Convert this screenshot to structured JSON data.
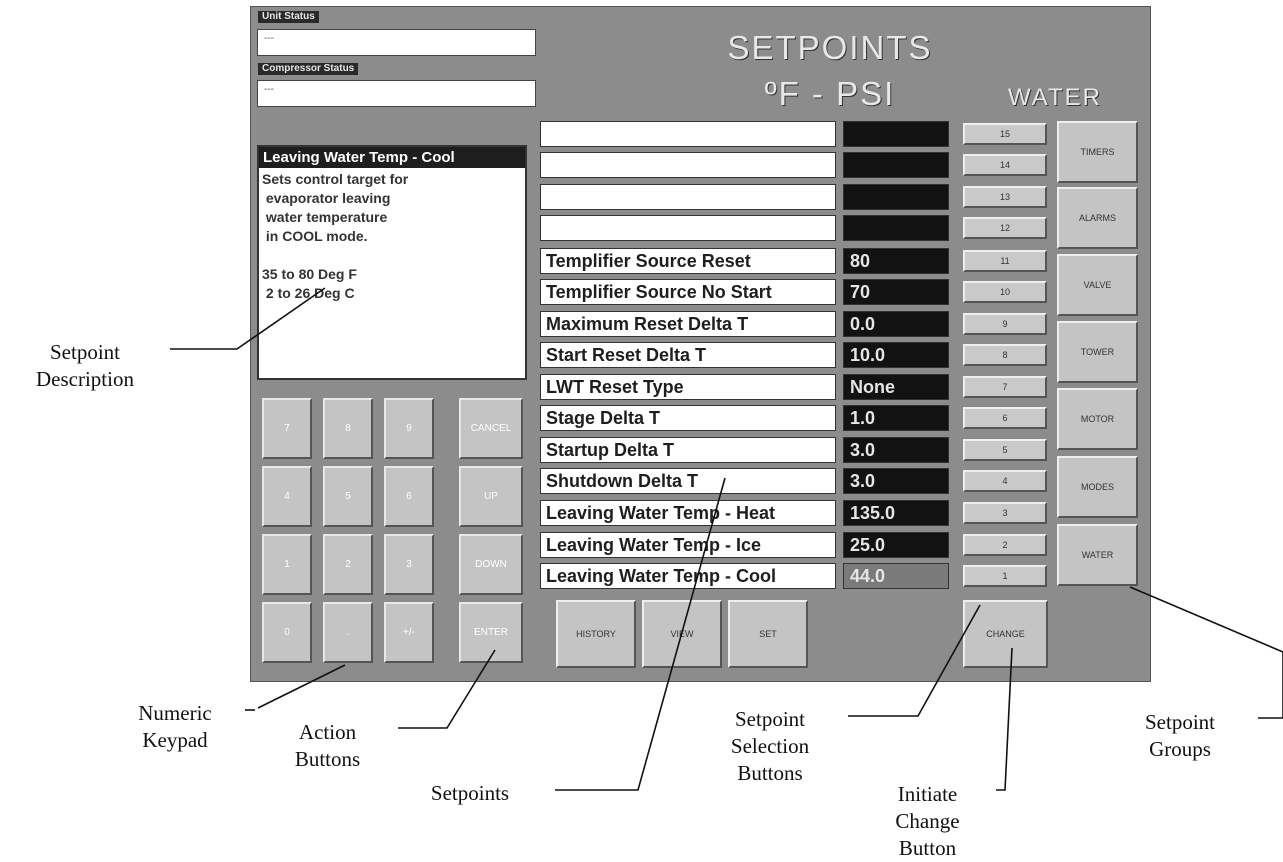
{
  "status": {
    "unit_label": "Unit Status",
    "unit_value": "---",
    "compressor_label": "Compressor Status",
    "compressor_value": "---"
  },
  "title": {
    "line1": "SETPOINTS",
    "line2": "ºF - PSI",
    "group": "WATER"
  },
  "description": {
    "heading": "Leaving Water Temp - Cool",
    "text": "Sets control target for\n evaporator leaving\n water temperature\n in COOL mode.\n\n35 to 80 Deg F\n 2 to 26 Deg C"
  },
  "keypad": {
    "keys": [
      "7",
      "8",
      "9",
      "4",
      "5",
      "6",
      "1",
      "2",
      "3",
      "0",
      ".",
      "+/-"
    ],
    "actions": [
      "CANCEL",
      "UP",
      "DOWN",
      "ENTER"
    ]
  },
  "setpoints": [
    {
      "name": "",
      "value": ""
    },
    {
      "name": "",
      "value": ""
    },
    {
      "name": "",
      "value": ""
    },
    {
      "name": "",
      "value": ""
    },
    {
      "name": "Templifier Source Reset",
      "value": "80"
    },
    {
      "name": "Templifier Source No Start",
      "value": "70"
    },
    {
      "name": "Maximum Reset Delta T",
      "value": "0.0"
    },
    {
      "name": "Start Reset Delta T",
      "value": "10.0"
    },
    {
      "name": "LWT Reset Type",
      "value": "None"
    },
    {
      "name": "Stage Delta T",
      "value": "1.0"
    },
    {
      "name": "Startup Delta T",
      "value": "3.0"
    },
    {
      "name": "Shutdown Delta T",
      "value": "3.0"
    },
    {
      "name": "Leaving Water Temp - Heat",
      "value": "135.0"
    },
    {
      "name": "Leaving Water Temp - Ice",
      "value": "25.0"
    },
    {
      "name": "Leaving Water Temp - Cool",
      "value": "44.0"
    }
  ],
  "selection_buttons": [
    "15",
    "14",
    "13",
    "12",
    "11",
    "10",
    "9",
    "8",
    "7",
    "6",
    "5",
    "4",
    "3",
    "2",
    "1"
  ],
  "groups": [
    "TIMERS",
    "ALARMS",
    "VALVE",
    "TOWER",
    "MOTOR",
    "MODES",
    "WATER"
  ],
  "bottom_buttons": {
    "history": "HISTORY",
    "view": "VIEW",
    "set": "SET",
    "change": "CHANGE"
  },
  "callouts": {
    "setpoint_description": [
      "Setpoint",
      "Description"
    ],
    "numeric_keypad": [
      "Numeric",
      "Keypad"
    ],
    "action_buttons": [
      "Action",
      "Buttons"
    ],
    "setpoints": [
      "Setpoints"
    ],
    "selection_buttons": [
      "Setpoint",
      "Selection",
      "Buttons"
    ],
    "initiate_change": [
      "Initiate",
      "Change",
      "Button"
    ],
    "setpoint_groups": [
      "Setpoint",
      "Groups"
    ]
  }
}
